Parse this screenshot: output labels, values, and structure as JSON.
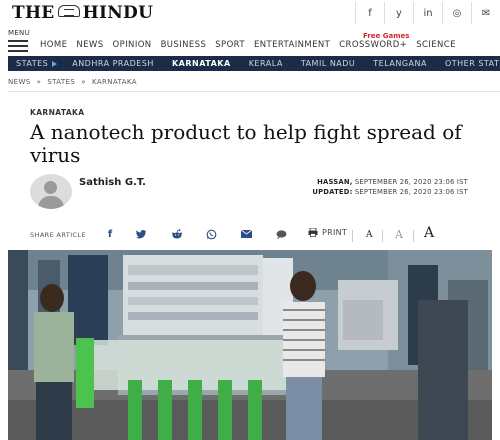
{
  "header": {
    "logo_text_left": "THE",
    "logo_text_right": "HINDU",
    "social": [
      {
        "icon": "facebook-icon",
        "glyph": "f"
      },
      {
        "icon": "twitter-icon",
        "glyph": "y"
      },
      {
        "icon": "linkedin-icon",
        "glyph": "in"
      },
      {
        "icon": "instagram-icon",
        "glyph": "◎"
      },
      {
        "icon": "email-icon",
        "glyph": "✉"
      }
    ]
  },
  "menu": {
    "label": "MENU",
    "items": [
      "HOME",
      "NEWS",
      "OPINION",
      "BUSINESS",
      "SPORT",
      "ENTERTAINMENT",
      "CROSSWORD+",
      "SCIENCE"
    ],
    "free_games": "Free Games"
  },
  "states": {
    "label": "STATES",
    "items": [
      "ANDHRA PRADESH",
      "KARNATAKA",
      "KERALA",
      "TAMIL NADU",
      "TELANGANA",
      "OTHER STATES"
    ],
    "active": "KARNATAKA"
  },
  "breadcrumb": [
    "NEWS",
    "»",
    "STATES",
    "»",
    "KARNATAKA"
  ],
  "article": {
    "kicker": "KARNATAKA",
    "headline": "A nanotech product to help fight spread of virus",
    "author": "Sathish G.T.",
    "place": "HASSAN,",
    "date": "SEPTEMBER 26, 2020 23:06 IST",
    "updated_label": "UPDATED:",
    "updated_date": "SEPTEMBER 26, 2020 23:06 IST"
  },
  "share": {
    "label": "SHARE ARTICLE",
    "print_label": "PRINT",
    "font_sizes": [
      "A",
      "A",
      "A"
    ]
  },
  "colors": {
    "states_bar": "#1a2c48",
    "accent_red": "#d3272f",
    "share_icon": "#2b4e83"
  }
}
